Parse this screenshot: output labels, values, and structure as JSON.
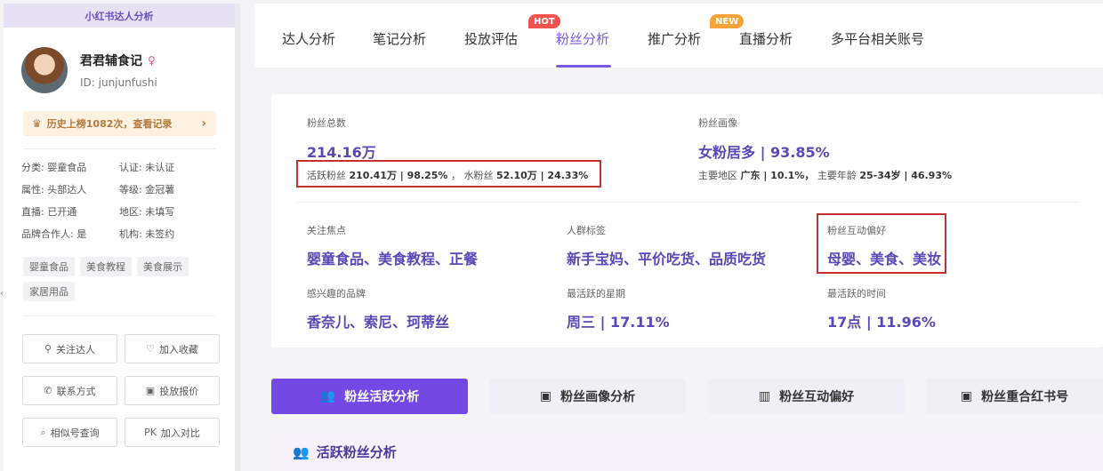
{
  "sidebar": {
    "title": "小红书达人分析",
    "name": "君君辅食记",
    "id": "ID: junjunfushi",
    "history": "历史上榜1082次，查看记录",
    "attributes": [
      "分类: 婴童食品",
      "认证: 未认证",
      "属性: 头部达人",
      "等级: 金冠薯",
      "直播: 已开通",
      "地区: 未填写",
      "品牌合作人: 是",
      "机构: 未签约"
    ],
    "tags": [
      "婴童食品",
      "美食教程",
      "美食展示",
      "家居用品"
    ],
    "actions": [
      "关注达人",
      "加入收藏",
      "联系方式",
      "投放报价",
      "相似号查询",
      "加入对比"
    ],
    "action_icons": [
      "follow-icon",
      "heart-icon",
      "phone-icon",
      "quote-icon",
      "search-icon",
      "pk-icon"
    ],
    "pk_label": "PK"
  },
  "tabs": [
    "达人分析",
    "笔记分析",
    "投放评估",
    "粉丝分析",
    "推广分析",
    "直播分析",
    "多平台相关账号"
  ],
  "active_tab": "粉丝分析",
  "badges": {
    "hot": "HOT",
    "new": "NEW"
  },
  "stats": {
    "fans_total_label": "粉丝总数",
    "fans_total": "214.16万",
    "active_label": "活跃粉丝",
    "active_value": "210.41万 | 98.25%",
    "comma": "，",
    "water_label": "水粉丝",
    "water_value": "52.10万 | 24.33%",
    "portrait_label": "粉丝画像",
    "portrait_value": "女粉居多 | 93.85%",
    "region_label": "主要地区",
    "region_value": "广东 | 10.1%，",
    "age_label": "主要年龄",
    "age_value": "25-34岁 | 46.93%",
    "focus_label": "关注焦点",
    "focus_value": "婴童食品、美食教程、正餐",
    "crowd_label": "人群标签",
    "crowd_value": "新手宝妈、平价吃货、品质吃货",
    "interact_label": "粉丝互动偏好",
    "interact_value": "母婴、美食、美妆",
    "brand_label": "感兴趣的品牌",
    "brand_value": "香奈儿、索尼、珂蒂丝",
    "week_label": "最活跃的星期",
    "week_value": "周三 | 17.11%",
    "time_label": "最活跃的时间",
    "time_value": "17点 | 11.96%"
  },
  "subtabs": [
    "粉丝活跃分析",
    "粉丝画像分析",
    "粉丝互动偏好",
    "粉丝重合红书号"
  ],
  "section_title": "活跃粉丝分析",
  "colors": {
    "accent": "#7348e4",
    "highlight_box": "#c4312f"
  }
}
